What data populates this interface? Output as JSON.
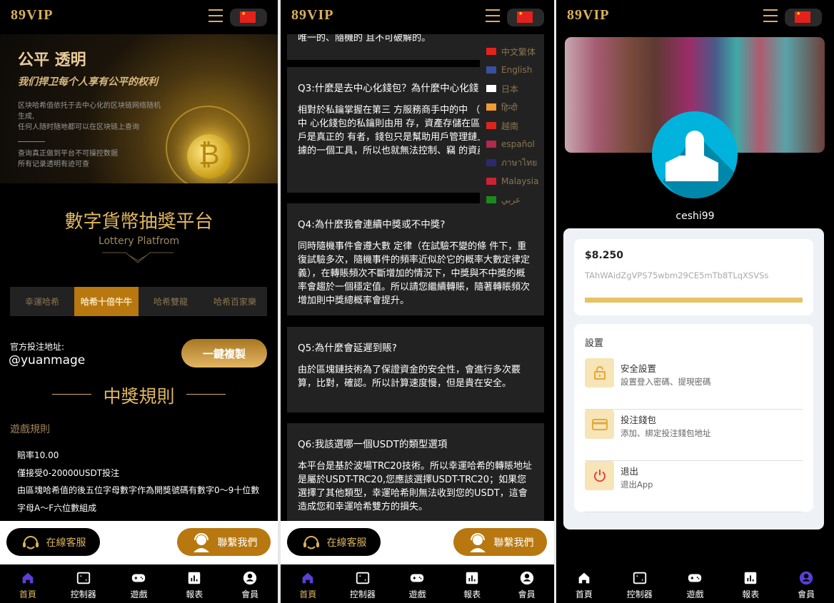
{
  "brand": {
    "logo": "89VIP",
    "accent": "#d9b15a",
    "active_tab_color": "#b8780f"
  },
  "header": {
    "menu_icon": "hamburger-icon",
    "language_flag": "china-flag"
  },
  "home": {
    "banner": {
      "title": "公平 透明",
      "subtitle": "我们捍卫每个人享有公平的权利",
      "desc1": "区块哈希值依托于去中心化的区块链网络随机生成,",
      "desc2": "任何人随时随地都可以在区块链上查询",
      "desc3": "查询真正做到平台不可操控数据",
      "desc4": "所有记录透明有迹可查"
    },
    "title": "數字貨幣抽獎平台",
    "subtitle": "Lottery Platfrom",
    "tabs": [
      {
        "label": "幸運哈希",
        "active": false
      },
      {
        "label": "哈希十倍牛牛",
        "active": true
      },
      {
        "label": "哈希雙龍",
        "active": false
      },
      {
        "label": "哈希百家樂",
        "active": false
      }
    ],
    "address_label": "官方投注地址:",
    "address": "@yuanmage",
    "copy_button": "一鍵複製",
    "rules_heading": "中獎規則",
    "game_rules_label": "遊戲規則",
    "rules": [
      "賠率10.00",
      "僅接受0-20000USDT投注",
      "由區塊哈希值的後五位字母數字作為開獎號碼有數字0～9十位數字母A～F六位數組成"
    ]
  },
  "float": {
    "service": "在線客服",
    "contact": "聯繫我們"
  },
  "nav": [
    {
      "label": "首頁",
      "icon": "home-icon"
    },
    {
      "label": "控制器",
      "icon": "controller-icon"
    },
    {
      "label": "遊戲",
      "icon": "gamepad-icon"
    },
    {
      "label": "報表",
      "icon": "chart-icon"
    },
    {
      "label": "會員",
      "icon": "member-icon"
    }
  ],
  "faq": [
    {
      "q": "",
      "a": "唯一的、隨機的 且不可破解的。"
    },
    {
      "q": "Q3:什麼是去中心化錢包？為什麼中心化錢",
      "a": "相對於私鑰掌握在第三 方服務商手中的中 （交易所），去中 心化錢包的私鑰則由用 存，資產存儲在區塊鏈上，用戶是真正的 有者，錢包只是幫助用戶管理鏈上資產和 數據的一個工具，所以也就無法控制、竊 的資產。"
    },
    {
      "q": "Q4:為什麼我會連續中獎或不中獎?",
      "a": "同時隨機事件會遵大數 定律（在試驗不變的條 件下，重復試驗多次，隨機事件的頻率近似於它的概率大數定律定義），在轉賬頻次不斷增加的情況下，中獎與不中獎的概率會趨於一個穩定值。所以請您繼續轉賬，隨著轉賬頻次增加則中獎總概率會提升。"
    },
    {
      "q": "Q5:為什麼會延遲到賬?",
      "a": "由於區塊鏈技術為了保證資金的安全性，會進行多次覈算，比對，確認。所以計算速度慢，但是貴在安全。"
    },
    {
      "q": "Q6:我該選哪一個USDT的類型選項",
      "a": "本平台是基於波場TRC20技術。所以幸運哈希的轉賬地址是屬於USDT-TRC20,您應該選擇USDT-TRC20；如果您選擇了其他類型，幸運哈希則無法收到您的USDT，這會造成您和幸運哈希雙方的損失。"
    }
  ],
  "languages": [
    {
      "label": "中文繁体",
      "flag": "#e5211c"
    },
    {
      "label": "English",
      "flag": "#3b4f9c"
    },
    {
      "label": "日本",
      "flag": "#ffffff"
    },
    {
      "label": "हिन्दी",
      "flag": "#f39a33"
    },
    {
      "label": "越南",
      "flag": "#da251d"
    },
    {
      "label": "español",
      "flag": "#b22a4a"
    },
    {
      "label": "ภาษาไทย",
      "flag": "#2d2a6b"
    },
    {
      "label": "Malaysia",
      "flag": "#cc2233"
    },
    {
      "label": "عربي",
      "flag": "#1a8a1a"
    }
  ],
  "member": {
    "username": "ceshi99",
    "balance": "$8.250",
    "wallet": "TAhWAidZgVPS75wbm29CE5mTb8TLqXSVSs",
    "progress_percent": 100,
    "settings_title": "設置",
    "items": [
      {
        "title": "安全設置",
        "desc": "設置登入密碼、提現密碼",
        "icon": "lock-icon"
      },
      {
        "title": "投注錢包",
        "desc": "添加、綁定投注錢包地址",
        "icon": "card-icon"
      },
      {
        "title": "退出",
        "desc": "退出App",
        "icon": "power-icon"
      }
    ]
  }
}
